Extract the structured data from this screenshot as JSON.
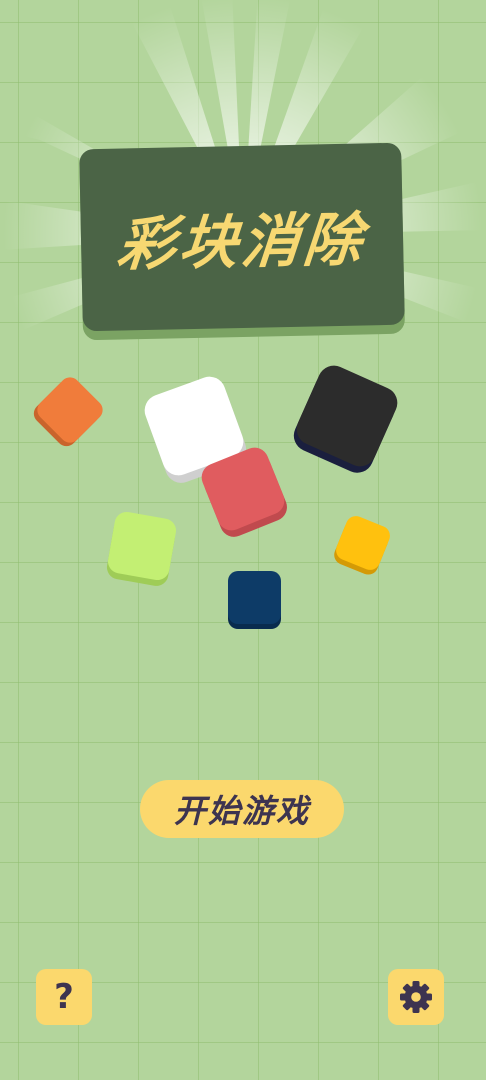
{
  "title": "彩块消除",
  "start_button_label": "开始游戏",
  "help_button_label": "?",
  "icons": {
    "help": "question-mark-icon",
    "settings": "gear-icon"
  },
  "colors": {
    "background": "#b3d59c",
    "grid_line": "#8fbe70",
    "title_board": "#4b6446",
    "title_text": "#f7d872",
    "button": "#fbd86d",
    "button_text": "#3d3450"
  },
  "blocks": [
    {
      "color": "orange",
      "hex": "#f07c3b"
    },
    {
      "color": "white",
      "hex": "#ffffff"
    },
    {
      "color": "black",
      "hex": "#2c2c2c"
    },
    {
      "color": "red",
      "hex": "#e05c5f"
    },
    {
      "color": "lime",
      "hex": "#c3ef73"
    },
    {
      "color": "yellow",
      "hex": "#ffc10e"
    },
    {
      "color": "navy",
      "hex": "#0d3b67"
    }
  ]
}
